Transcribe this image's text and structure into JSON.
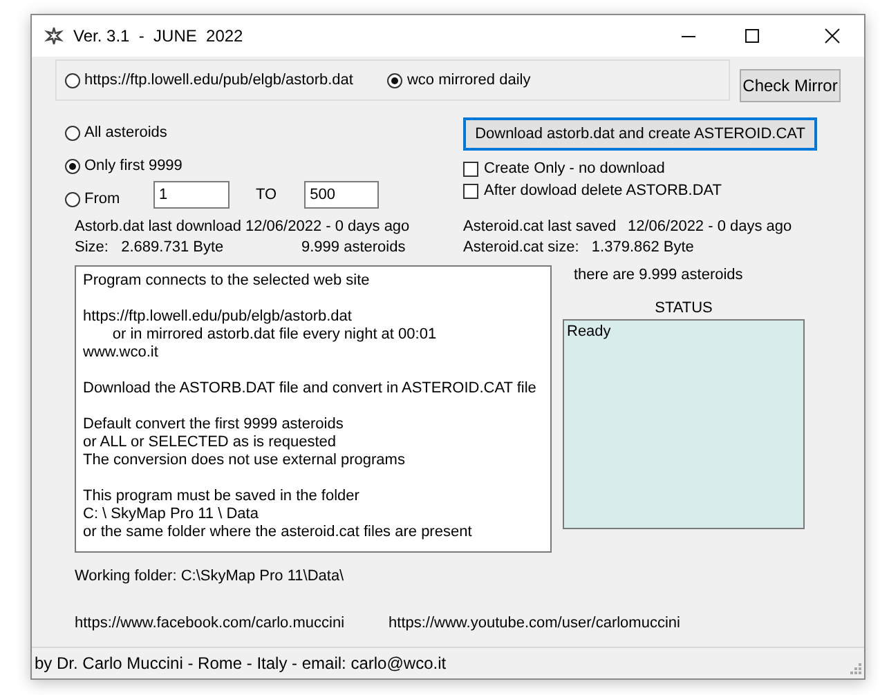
{
  "window": {
    "title": "Ver. 3.1  -  JUNE  2022"
  },
  "source": {
    "options": [
      {
        "label": "https://ftp.lowell.edu/pub/elgb/astorb.dat",
        "selected": false
      },
      {
        "label": "wco mirrored daily",
        "selected": true
      }
    ],
    "check_button": "Check Mirror"
  },
  "range": {
    "options": [
      {
        "label": "All asteroids",
        "selected": false
      },
      {
        "label": "Only first 9999",
        "selected": true
      },
      {
        "label": "From",
        "selected": false
      }
    ],
    "from_value": "1",
    "to_label": "TO",
    "to_value": "500"
  },
  "download_button": "Download astorb.dat and create ASTEROID.CAT",
  "checkboxes": [
    {
      "label": "Create Only - no download",
      "checked": false
    },
    {
      "label": "After dowload delete ASTORB.DAT",
      "checked": false
    }
  ],
  "astorb_info": {
    "last_download": "Astorb.dat last download 12/06/2022 - 0 days ago",
    "size": "Size:   2.689.731 Byte",
    "count": "9.999 asteroids"
  },
  "catalog_info": {
    "last_saved_label": "Asteroid.cat last saved",
    "last_saved": "12/06/2022 - 0 days ago",
    "size": "Asteroid.cat size:   1.379.862 Byte"
  },
  "description": [
    "Program connects to the selected web site",
    "https://ftp.lowell.edu/pub/elgb/astorb.dat\n       or in mirrored astorb.dat file every night at 00:01\nwww.wco.it",
    "Download the ASTORB.DAT file and convert in ASTEROID.CAT file",
    "Default convert the first 9999 asteroids\nor ALL or SELECTED as is requested\nThe conversion does not use external programs",
    "This program must be saved in the folder\nC: \\ SkyMap Pro 11 \\ Data\nor the same folder where the asteroid.cat files are present"
  ],
  "asteroid_count": "there are 9.999 asteroids",
  "status": {
    "label": "STATUS",
    "text": "Ready"
  },
  "working_folder": "Working folder: C:\\SkyMap Pro 11\\Data\\",
  "links": [
    "https://www.facebook.com/carlo.muccini",
    "https://www.youtube.com/user/carlomuccini"
  ],
  "status_bar": "by Dr. Carlo Muccini  -  Rome - Italy - email: carlo@wco.it"
}
